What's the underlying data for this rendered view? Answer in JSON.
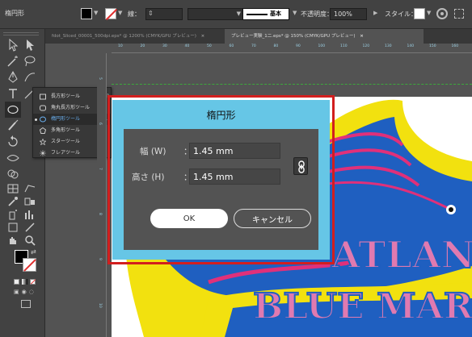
{
  "control_bar": {
    "tool_name": "楕円形",
    "stroke_label": "線：",
    "profile_label": "基本",
    "opacity_label": "不透明度：",
    "opacity_value": "100%",
    "style_label": "スタイル："
  },
  "tabs": [
    {
      "label": "fdot_Sliced_00001_500dpi.eps* @ 1200% (CMYK/GPU プレビュー)",
      "close": "×"
    },
    {
      "label": "プレビュー実験_1二.eps* @ 150% (CMYK/GPU プレビュー)",
      "close": "×"
    }
  ],
  "flyout": {
    "items": [
      {
        "label": "長方形ツール",
        "key": "(M)"
      },
      {
        "label": "角丸長方形ツール",
        "key": ""
      },
      {
        "label": "楕円形ツール",
        "key": "(L)"
      },
      {
        "label": "多角形ツール",
        "key": ""
      },
      {
        "label": "スターツール",
        "key": ""
      },
      {
        "label": "フレアツール",
        "key": ""
      }
    ]
  },
  "ruler": {
    "top": [
      "10",
      "20",
      "30",
      "40",
      "50",
      "60",
      "70",
      "80",
      "90",
      "100",
      "110",
      "120",
      "130",
      "140",
      "150",
      "160"
    ],
    "left": [
      "5",
      "6",
      "7",
      "8",
      "9",
      "10"
    ]
  },
  "artwork": {
    "line1": "ATLAN",
    "line2": "BLUE MAR"
  },
  "dialog": {
    "title": "楕円形",
    "width_label": "幅 (W)",
    "height_label": "高さ (H)",
    "colon": "：",
    "width_value": "1.45 mm",
    "height_value": "1.45 mm",
    "ok_label": "OK",
    "cancel_label": "キャンセル"
  },
  "colors": {
    "highlight": "#d21e1e",
    "dialog_bg": "#66c6e6",
    "panel_bg": "#535353",
    "fish_blue": "#1f5fc0",
    "fish_yellow": "#f2e10f",
    "fish_pink": "#e0307a",
    "text_pink": "#e07ab0"
  }
}
